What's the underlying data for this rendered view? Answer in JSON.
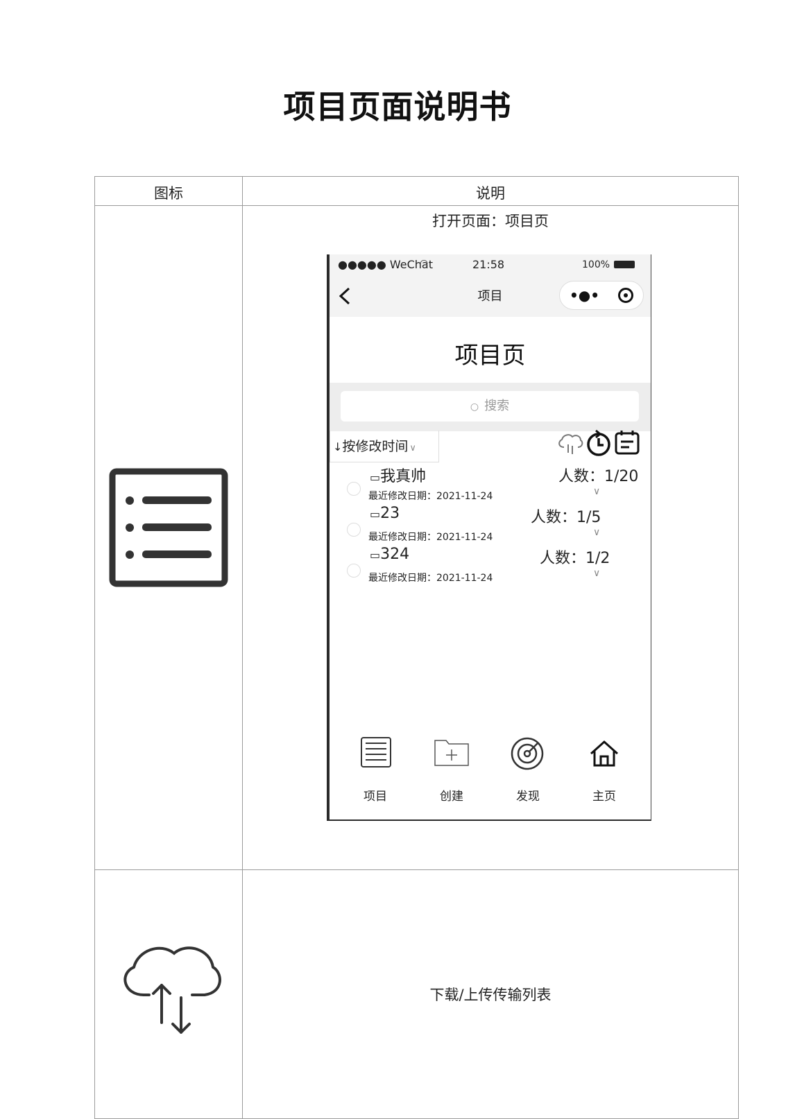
{
  "document": {
    "title": "项目页面说明书",
    "table": {
      "headers": [
        "图标",
        "说明"
      ],
      "rows": [
        {
          "icon": "list-icon",
          "description": "打开页面：项目页"
        },
        {
          "icon": "cloud-upload-download-icon",
          "description": "下载/上传传输列表"
        }
      ]
    }
  },
  "phone": {
    "status_bar": {
      "carrier": "●●●●● WeChat",
      "time": "21:58",
      "battery": "100%"
    },
    "nav_bar": {
      "title": "项目",
      "capsule_more": "•●•"
    },
    "page_title": "项目页",
    "search": {
      "placeholder": "搜索"
    },
    "sort": {
      "label": "按修改时间"
    },
    "projects": [
      {
        "name": "我真帅",
        "date_label": "最近修改日期：",
        "date": "2021-11-24",
        "count_label": "人数：",
        "count": "1/20"
      },
      {
        "name": "23",
        "date_label": "最近修改日期：",
        "date": "2021-11-24",
        "count_label": "人数：",
        "count": "1/5"
      },
      {
        "name": "324",
        "date_label": "最近修改日期：",
        "date": "2021-11-24",
        "count_label": "人数：",
        "count": "1/2"
      }
    ],
    "tab_bar": [
      {
        "label": "项目",
        "icon": "list-box-icon"
      },
      {
        "label": "创建",
        "icon": "folder-add-icon"
      },
      {
        "label": "发现",
        "icon": "radar-icon"
      },
      {
        "label": "主页",
        "icon": "home-icon"
      }
    ]
  }
}
